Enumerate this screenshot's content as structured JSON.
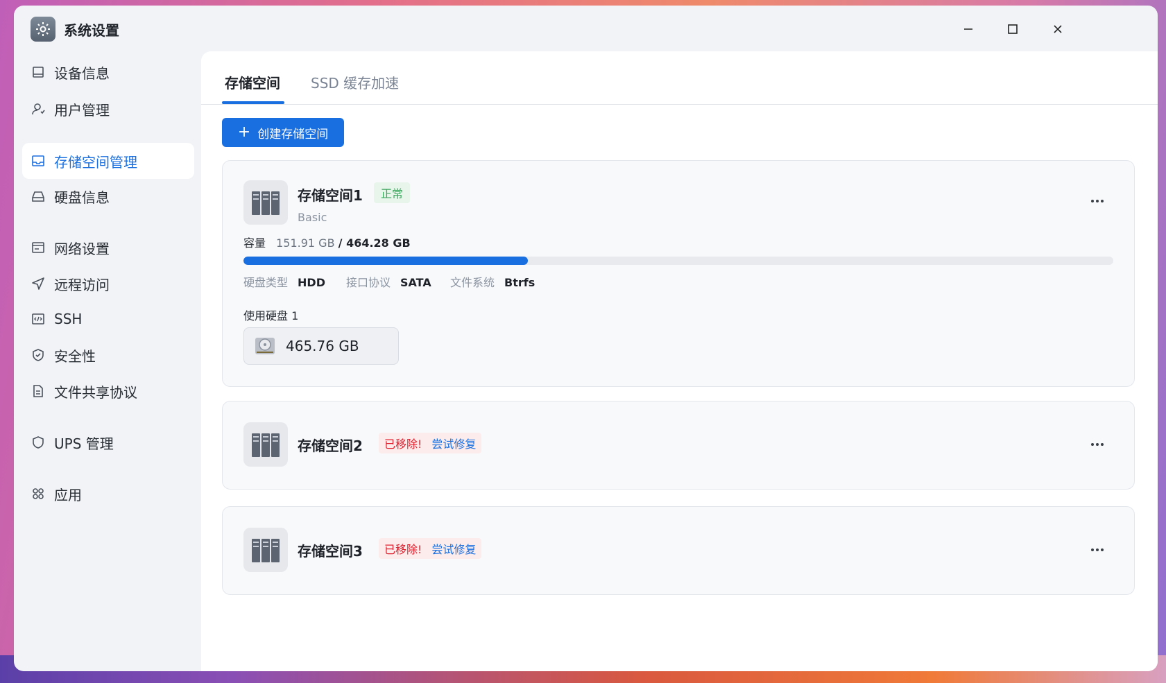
{
  "window": {
    "title": "系统设置"
  },
  "sidebar": {
    "items": [
      {
        "label": "设备信息",
        "icon": "device-icon"
      },
      {
        "label": "用户管理",
        "icon": "user-icon"
      },
      {
        "label": "存储空间管理",
        "icon": "storage-icon",
        "active": true
      },
      {
        "label": "硬盘信息",
        "icon": "disk-icon"
      },
      {
        "label": "网络设置",
        "icon": "network-icon"
      },
      {
        "label": "远程访问",
        "icon": "send-icon"
      },
      {
        "label": "SSH",
        "icon": "code-icon"
      },
      {
        "label": "安全性",
        "icon": "shield-check-icon"
      },
      {
        "label": "文件共享协议",
        "icon": "file-icon"
      },
      {
        "label": "UPS 管理",
        "icon": "shield-icon"
      },
      {
        "label": "应用",
        "icon": "apps-icon"
      }
    ]
  },
  "tabs": [
    {
      "label": "存储空间",
      "active": true
    },
    {
      "label": "SSD 缓存加速",
      "active": false
    }
  ],
  "create_button": {
    "label": "创建存储空间"
  },
  "pools": [
    {
      "name": "存储空间1",
      "status": "正常",
      "type": "Basic",
      "capacity_label": "容量",
      "used": "151.91 GB",
      "total": "/ 464.28 GB",
      "usage_fraction": 0.327,
      "disk_type_label": "硬盘类型",
      "disk_type": "HDD",
      "interface_label": "接口协议",
      "interface": "SATA",
      "fs_label": "文件系统",
      "fs": "Btrfs",
      "disks_label": "使用硬盘 1",
      "disk_size": "465.76 GB"
    },
    {
      "name": "存储空间2",
      "status": "已移除!",
      "action": "尝试修复"
    },
    {
      "name": "存储空间3",
      "status": "已移除!",
      "action": "尝试修复"
    }
  ],
  "colors": {
    "accent": "#1a6fe0",
    "ok": "#3aa55c",
    "error": "#e0202e"
  }
}
